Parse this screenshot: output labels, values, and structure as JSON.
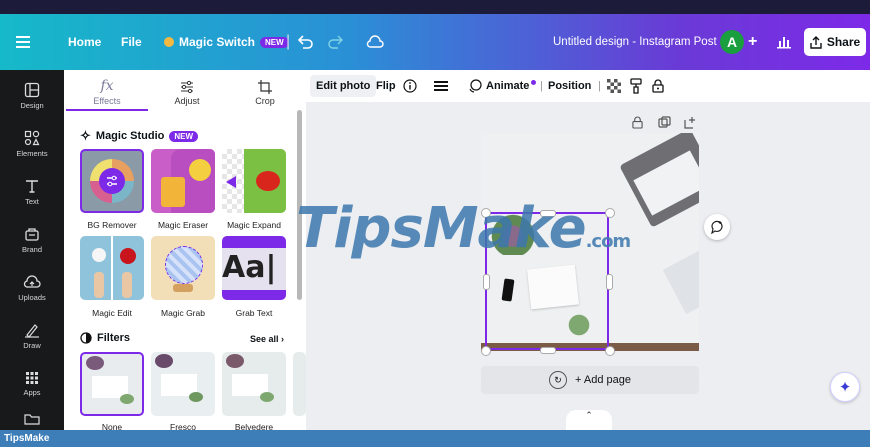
{
  "header": {
    "home": "Home",
    "file": "File",
    "magic_switch": "Magic Switch",
    "magic_switch_badge": "NEW",
    "title": "Untitled design - Instagram Post",
    "avatar_initial": "A",
    "share": "Share"
  },
  "rail": {
    "items": [
      "Design",
      "Elements",
      "Text",
      "Brand",
      "Uploads",
      "Draw",
      "Apps"
    ]
  },
  "panel": {
    "tabs": [
      "Effects",
      "Adjust",
      "Crop"
    ],
    "magic_studio": {
      "title": "Magic Studio",
      "badge": "NEW",
      "items": [
        "BG Remover",
        "Magic Eraser",
        "Magic Expand",
        "Magic Edit",
        "Magic Grab",
        "Grab Text"
      ]
    },
    "filters": {
      "title": "Filters",
      "see_all": "See all",
      "items": [
        "None",
        "Fresco",
        "Belvedere"
      ]
    }
  },
  "toolbar": {
    "edit_photo": "Edit photo",
    "flip": "Flip",
    "animate": "Animate",
    "position": "Position"
  },
  "canvas": {
    "add_page": "+ Add page"
  },
  "watermark": {
    "text": "TipsMake",
    "suffix": ".com"
  },
  "footer": {
    "brand": "TipsMake"
  },
  "colors": {
    "accent": "#7d2ae8",
    "rail_bg": "#18191b"
  }
}
